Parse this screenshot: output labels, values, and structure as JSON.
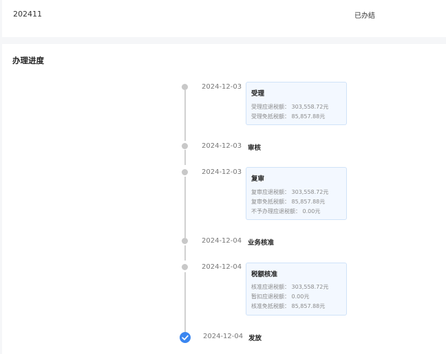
{
  "header": {
    "period": "202411",
    "status": "已办结"
  },
  "progress": {
    "title": "办理进度",
    "steps": [
      {
        "date": "2024-12-03",
        "label": "受理",
        "details": [
          "受理应退税额： 303,558.72元",
          "受理免抵税额： 85,857.88元"
        ]
      },
      {
        "date": "2024-12-03",
        "label": "审核",
        "details": []
      },
      {
        "date": "2024-12-03",
        "label": "复审",
        "details": [
          "复审应退税额： 303,558.72元",
          "复审免抵税额： 85,857.88元",
          "不予办理应退税额： 0.00元"
        ]
      },
      {
        "date": "2024-12-04",
        "label": "业务核准",
        "details": []
      },
      {
        "date": "2024-12-04",
        "label": "税额核准",
        "details": [
          "核准应退税额： 303,558.72元",
          "暂扣应退税额： 0.00元",
          "核准免抵税额： 85,857.88元"
        ]
      },
      {
        "date": "2024-12-04",
        "label": "发放",
        "details": []
      }
    ]
  },
  "colors": {
    "accent": "#3a86f0",
    "box_bg": "#f3f8ff",
    "box_border": "#cfe2f8"
  }
}
